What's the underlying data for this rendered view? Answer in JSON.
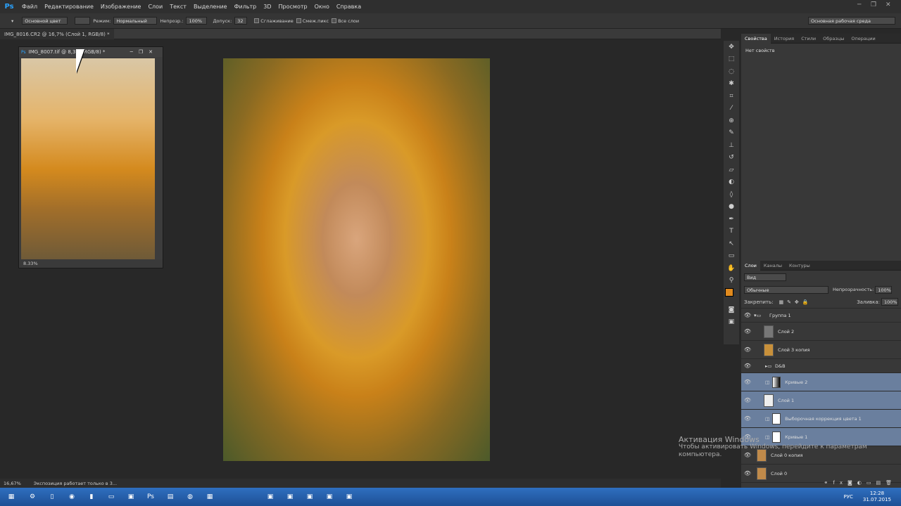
{
  "app": {
    "logo": "Ps"
  },
  "menu": [
    "Файл",
    "Редактирование",
    "Изображение",
    "Слои",
    "Текст",
    "Выделение",
    "Фильтр",
    "3D",
    "Просмотр",
    "Окно",
    "Справка"
  ],
  "options": {
    "brush_mode_label": "Основной цвет",
    "mode_label": "Режим:",
    "mode_value": "Нормальный",
    "opacity_label": "Непрозр.:",
    "opacity_value": "100%",
    "tolerance_label": "Допуск:",
    "tolerance_value": "32",
    "smoothing_label": "Сглаживание",
    "contiguous_label": "Смеж.пикс",
    "all_layers_label": "Все слои",
    "workspace_value": "Основная рабочая среда"
  },
  "doc_tab": {
    "title": "IMG_8016.CR2 @ 16,7% (Слой 1, RGB/8) *"
  },
  "float_window": {
    "title": "IMG_8007.tif @ 8,3... (RGB/8) *",
    "zoom": "8.33%"
  },
  "statusbar": {
    "zoom": "16,67%",
    "text": "Экспозиция работает только в 3..."
  },
  "props_panel": {
    "tabs": [
      "Свойства",
      "История",
      "Стили",
      "Образцы",
      "Операции"
    ],
    "empty_text": "Нет свойств"
  },
  "layers_panel": {
    "tabs": [
      "Слои",
      "Каналы",
      "Контуры"
    ],
    "filter_value": "Вид",
    "blend_value": "Обычные",
    "opacity_label": "Непрозрачность:",
    "opacity_value": "100%",
    "lock_label": "Закрепить:",
    "fill_label": "Заливка:",
    "fill_value": "100%",
    "layers": [
      {
        "name": "Группа 1",
        "type": "group",
        "selected": false
      },
      {
        "name": "Слой 2",
        "type": "gray",
        "selected": false
      },
      {
        "name": "Слой 3 копия",
        "type": "photo",
        "selected": false
      },
      {
        "name": "D&B",
        "type": "group",
        "selected": false
      },
      {
        "name": "Кривые 2",
        "type": "adjust",
        "selected": true
      },
      {
        "name": "Слой 1",
        "type": "blank",
        "selected": true
      },
      {
        "name": "Выборочная коррекция цвета 1",
        "type": "adjust",
        "selected": true
      },
      {
        "name": "Кривые 1",
        "type": "adjust",
        "selected": true
      },
      {
        "name": "Слой 0 копия",
        "type": "photo",
        "selected": false
      },
      {
        "name": "Слой 0",
        "type": "photo",
        "selected": false
      }
    ]
  },
  "windows_activation": {
    "title": "Активация Windows",
    "line1": "Чтобы активировать Windows, перейдите к параметрам",
    "line2": "компьютера."
  },
  "taskbar": {
    "lang": "РУС",
    "time": "12:28",
    "date": "31.07.2015"
  },
  "colors": {
    "fg": "#e08a1e",
    "bg": "#ffffff",
    "selection": "#6a7f9e"
  }
}
